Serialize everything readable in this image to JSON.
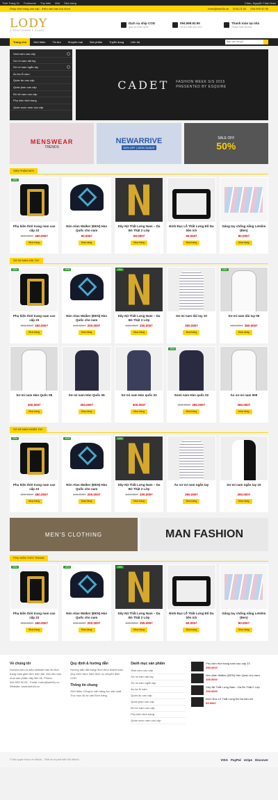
{
  "adminbar": {
    "items": [
      "Thời Trang 01",
      "Footsome",
      "Tùy biến",
      "Mới",
      "Sửa trang"
    ],
    "greeting": "Chào, Nguyễn Tuấn Nam"
  },
  "topbar": {
    "left": "Shop thời trang cao cấp - thiêu sản bạn lưu chọn",
    "email": "hotro@web2s.vn",
    "hours": "8:00-21:00",
    "phone": "094.999.92.95"
  },
  "header": {
    "logo": "LODY",
    "logo_sub": "A GENTLEMEN'S CLASS",
    "features": [
      {
        "t": "Dịch vụ ship COD",
        "s": "giao và nhận quốc"
      },
      {
        "t": "094.999.92.95",
        "s": "Hỗ trợ miễn phí 24/7"
      },
      {
        "t": "Thanh toán tại nhà",
        "s": "Thanh toán tại nhà"
      }
    ]
  },
  "nav": {
    "items": [
      "Trang chủ",
      "Giới thiệu",
      "Tin tức",
      "Khuyến mại",
      "Sản phẩm",
      "Tuyển dụng",
      "Liên hệ"
    ],
    "search_placeholder": "Bạn cần tìm gì?"
  },
  "menu": [
    "Vest nam cao cấp",
    "Sơ mi nam dài tay",
    "Sơ mi nam ngắn tay",
    "Áo ba lỗ nam",
    "Quần âu cao cấp",
    "Quần jean cao cấp",
    "Đồ lót nam cao cấp",
    "Phụ kiện thời trang",
    "Quần soóc nam cao cấp"
  ],
  "slide": {
    "brand": "CADET",
    "caption": [
      "FASHION WEEK S/S 2015",
      "PRESENTED BY ESQUIRE"
    ]
  },
  "banners": [
    {
      "t": "MENSWEAR",
      "s": "TRENDS"
    },
    {
      "t": "NEWARRIVE",
      "s": "50% OFF | 100% SUAVE"
    },
    {
      "t": "50%",
      "s": "SALE OFF"
    }
  ],
  "sections": [
    {
      "title": "Sản phẩm mới",
      "rows": [
        [
          {
            "img": "buckle",
            "badge": "29%",
            "name": "Phụ kiện thời trang nam cao cấp 23",
            "old": "360.000₫",
            "price": "450.000₫",
            "btn": "Mua hàng"
          },
          {
            "img": "cap",
            "badge": "",
            "name": "Nón Alan Walker (ĐEN) Hàn Quốc cho nam",
            "old": "",
            "price": "60.000₫",
            "btn": "Mua hàng"
          },
          {
            "img": "nbuckle",
            "badge": "",
            "name": "Dây Nịt Thắt Lưng Nam – Da Bò Thật 2 Lớp",
            "old": "",
            "price": "60.000₫",
            "btn": "Mua hàng"
          },
          {
            "img": "belt",
            "badge": "",
            "name": "Đinh Đục Lỗ Thắt Lưng Đồ Da tiện ích",
            "old": "",
            "price": "60.000₫",
            "btn": "Mua hàng"
          },
          {
            "img": "belts",
            "badge": "",
            "name": "Găng tay chống nắng Letslim (Đen)",
            "old": "",
            "price": "80.000₫",
            "btn": "Mua hàng"
          }
        ]
      ]
    },
    {
      "title": "Sơ mi nam dài tay",
      "rows": [
        [
          {
            "img": "buckle",
            "badge": "29%",
            "name": "Phụ kiện thời trang nam cao cấp 23",
            "old": "360.000₫",
            "price": "450.000₫",
            "btn": "Mua hàng"
          },
          {
            "img": "cap",
            "badge": "15%",
            "name": "Nón Alan Walker (ĐEN) Hàn Quốc cho nam",
            "old": "240.000₫",
            "price": "200.000₫",
            "btn": "Mua hàng"
          },
          {
            "img": "nbuckle",
            "badge": "15%",
            "name": "Dây Nịt Thắt Lưng Nam – Da Bò Thật 2 Lớp",
            "old": "240.000₫",
            "price": "200.000₫",
            "btn": "Mua hàng"
          },
          {
            "img": "shirtc",
            "badge": "",
            "name": "Sơ mi nam dài tay 10",
            "old": "",
            "price": "300.000₫",
            "btn": "Mua hàng"
          },
          {
            "img": "shirtw",
            "badge": "15%",
            "name": "Sơ mi nam dài tay 05",
            "old": "260.000₫",
            "price": "360.000₫",
            "btn": "Mua hàng"
          }
        ],
        [
          {
            "img": "shirtw",
            "badge": "",
            "name": "Sơ mi nam Hàn Quốc 08",
            "old": "",
            "price": "300.000₫",
            "btn": "Mua hàng"
          },
          {
            "img": "shirtd",
            "badge": "",
            "name": "Sơ mi nam Hàn Quốc 06",
            "old": "",
            "price": "300.000₫",
            "btn": "Mua hàng"
          },
          {
            "img": "shirtn",
            "badge": "",
            "name": "Sơ mi nam Hàn quốc 03",
            "old": "",
            "price": "300.000₫",
            "btn": "Mua hàng"
          },
          {
            "img": "shirtd",
            "badge": "15%",
            "name": "Somi nam Hàn quốc 02",
            "old": "350.000₫",
            "price": "280.000₫",
            "btn": "Mua hàng"
          },
          {
            "img": "shirtw",
            "badge": "",
            "name": "Áo sơ mi nam 508",
            "old": "",
            "price": "360.000₫",
            "btn": "Mua hàng"
          }
        ]
      ]
    },
    {
      "title": "Sơ mi nam ngắn tay",
      "rows": [
        [
          {
            "img": "buckle",
            "badge": "29%",
            "name": "Phụ kiện thời trang nam cao cấp 23",
            "old": "360.000₫",
            "price": "450.000₫",
            "btn": "Mua hàng"
          },
          {
            "img": "cap",
            "badge": "15%",
            "name": "Nón Alan Walker (ĐEN) Hàn Quốc cho nam",
            "old": "240.000₫",
            "price": "200.000₫",
            "btn": "Mua hàng"
          },
          {
            "img": "nbuckle",
            "badge": "15%",
            "name": "Dây Nịt Thắt Lưng Nam – Da Bò Thật 2 Lớp",
            "old": "240.000₫",
            "price": "200.000₫",
            "btn": "Mua hàng"
          },
          {
            "img": "shirtc",
            "badge": "",
            "name": "Áo sơ mi nam ngắn tay",
            "old": "",
            "price": "260.000₫",
            "btn": "Mua hàng"
          },
          {
            "img": "shirtbw",
            "badge": "",
            "name": "Sơ mi nam ngắn tay 19",
            "old": "",
            "price": "260.000₫",
            "btn": "Mua hàng"
          }
        ]
      ]
    },
    {
      "title": "Phụ kiện thời trang",
      "rows": [
        [
          {
            "img": "buckle",
            "badge": "29%",
            "name": "Phụ kiện thời trang nam cao cấp 23",
            "old": "360.000₫",
            "price": "450.000₫",
            "btn": "Mua hàng"
          },
          {
            "img": "cap",
            "badge": "15%",
            "name": "Nón Alan Walker (ĐEN) Hàn Quốc cho nam",
            "old": "240.000₫",
            "price": "200.000₫",
            "btn": "Mua hàng"
          },
          {
            "img": "nbuckle",
            "badge": "15%",
            "name": "Dây Nịt Thắt Lưng Nam – Da Bò Thật 2 Lớp",
            "old": "240.000₫",
            "price": "200.000₫",
            "btn": "Mua hàng"
          },
          {
            "img": "belt",
            "badge": "",
            "name": "Đinh Đục Lỗ Thắt Lưng Đồ Da tiện ích",
            "old": "",
            "price": "60.000₫",
            "btn": "Mua hàng"
          },
          {
            "img": "belts",
            "badge": "",
            "name": "Găng tay chống nắng Letslim (Đen)",
            "old": "",
            "price": "80.000₫",
            "btn": "Mua hàng"
          }
        ]
      ]
    }
  ],
  "mid_banners": [
    "MEN'S CLOTHING",
    "MAN FASHION"
  ],
  "footer": {
    "about": {
      "h": "Về chúng tôi",
      "t": "Donam.com là mẫu website bán đồ thời trang nam giản đơn hiện đại. Mọi nhu cầu mua sản phẩm hãy liên hệ. Phone: 094.999.92.95 · Email: hotro@web2s.vn · Website: www.web2s.vn"
    },
    "policy": {
      "h": "Quy định & hướng dẫn",
      "t": "Hướng dẫn đặt hàng Hình thức thanh toán Quy trình thực hiện Dịch vụ chuyển định COD",
      "h2": "Thông tin chung",
      "t2": "Giới thiệu Cổng tư vấn hàng lực sản xuất Thư mục đồ tư vấn Đơn hàng"
    },
    "cats": {
      "h": "Danh mục sản phẩm",
      "items": [
        "Vest nam cao cấp",
        "Sơ mi nam dài tay",
        "Sơ mi nam ngắn tay",
        "Áo ba lỗ nam",
        "Quần âu cao cấp",
        "Quần jean cao cấp",
        "Đồ lót nam cao cấp",
        "Phụ kiện thời trang",
        "Quần soóc nam cao cấp"
      ]
    },
    "products": [
      {
        "n": "Phụ kiện thời trang nam cao cấp 23",
        "p": "450.000₫"
      },
      {
        "n": "Nón Alan Walker (ĐEN) Hàn Quốc cho nam",
        "p": "200.000₫"
      },
      {
        "n": "Dây Nịt Thắt Lưng Nam - Da Bò Thật 2 Lớp",
        "p": "200.000₫"
      },
      {
        "n": "Đinh Đục Lỗ Thắt Lưng Đồ Da tiện ích",
        "p": "60.000₫"
      }
    ]
  },
  "copyright": "© Bản quyền thuộc về Web2s - Thiết kế và phát triển bởi Web2s",
  "payments": [
    "VISA",
    "PayPal",
    "stripe",
    "Discover"
  ]
}
